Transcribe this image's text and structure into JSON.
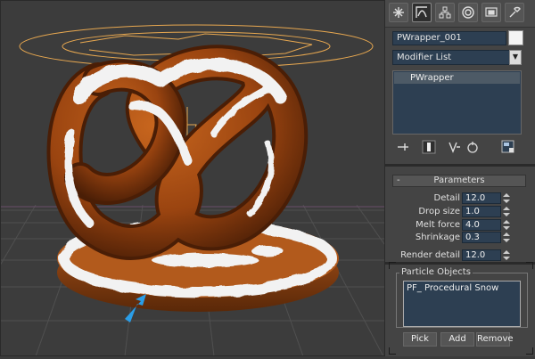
{
  "app": "3ds Max",
  "command_panel": {
    "tabs": [
      "create-tab",
      "modify-tab",
      "hierarchy-tab",
      "motion-tab",
      "display-tab",
      "utilities-tab"
    ],
    "active_tab": "modify-tab",
    "object_name": "PWrapper_001",
    "object_color": "#f4f4f4",
    "modifier_list_label": "Modifier List",
    "stack_items": [
      "PWrapper"
    ]
  },
  "parameters": {
    "rollout_title": "Parameters",
    "collapse_symbol": "-",
    "detail": {
      "label": "Detail",
      "value": "12.0"
    },
    "drop_size": {
      "label": "Drop size",
      "value": "1.0"
    },
    "melt_force": {
      "label": "Melt force",
      "value": "4.0"
    },
    "shrinkage": {
      "label": "Shrinkage",
      "value": "0.3"
    },
    "render_detail": {
      "label": "Render detail",
      "value": "12.0"
    }
  },
  "particle_objects": {
    "label": "Particle Objects",
    "items": [
      "PF_ Procedural Snow"
    ],
    "pick_label": "Pick",
    "add_label": "Add",
    "remove_label": "Remove"
  },
  "viewport": {
    "background": "#3c3c3c",
    "grid_color": "#505050",
    "object_color": "#a04a10",
    "snow_color": "#f2f2f2",
    "gizmo_color": "#e8a850",
    "pointer_color": "#2a9ee8"
  }
}
